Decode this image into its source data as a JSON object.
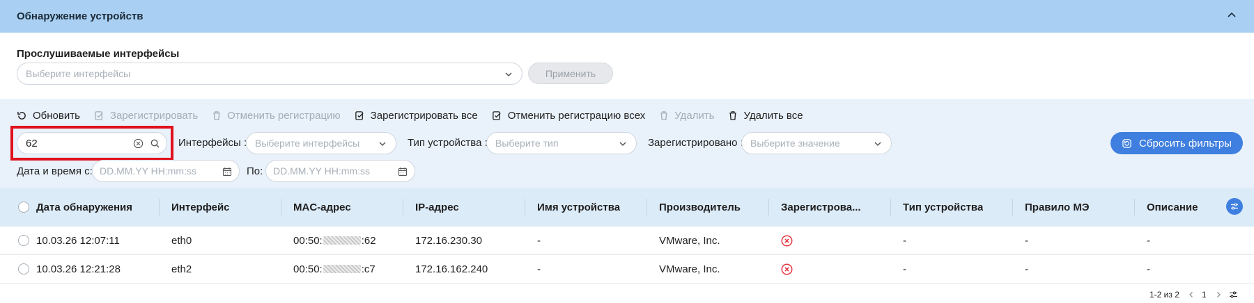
{
  "header": {
    "title": "Обнаружение устройств",
    "collapse_icon": "chevron-up-icon"
  },
  "listen": {
    "label": "Прослушиваемые интерфейсы",
    "placeholder": "Выберите интерфейсы",
    "apply_label": "Применить"
  },
  "toolbar": {
    "refresh": "Обновить",
    "register": "Зарегистрировать",
    "unregister": "Отменить регистрацию",
    "register_all": "Зарегистрировать все",
    "unregister_all": "Отменить регистрацию всех",
    "delete": "Удалить",
    "delete_all": "Удалить все"
  },
  "filters": {
    "search_value": "62",
    "interfaces_label": "Интерфейсы :",
    "interfaces_placeholder": "Выберите интерфейсы",
    "device_type_label": "Тип устройства :",
    "device_type_placeholder": "Выберите тип",
    "registered_label": "Зарегистрировано :",
    "registered_placeholder": "Выберите значение",
    "reset_label": "Сбросить фильтры",
    "date_from_label": "Дата и время с:",
    "date_from_placeholder": "DD.MM.YY HH:mm:ss",
    "date_to_label": "По:",
    "date_to_placeholder": "DD.MM.YY HH:mm:ss"
  },
  "table": {
    "columns": [
      "Дата обнаружения",
      "Интерфейс",
      "MAC-адрес",
      "IP-адрес",
      "Имя устройства",
      "Производитель",
      "Зарегистрова...",
      "Тип устройства",
      "Правило МЭ",
      "Описание"
    ],
    "rows": [
      {
        "date": "10.03.26 12:07:11",
        "iface": "eth0",
        "mac_prefix": "00:50:",
        "mac_suffix": ":62",
        "ip": "172.16.230.30",
        "name": "-",
        "vendor": "VMware, Inc.",
        "registered": "not-registered-icon",
        "type": "-",
        "rule": "-",
        "desc": "-"
      },
      {
        "date": "10.03.26 12:21:28",
        "iface": "eth2",
        "mac_prefix": "00:50:",
        "mac_suffix": ":c7",
        "ip": "172.16.162.240",
        "name": "-",
        "vendor": "VMware, Inc.",
        "registered": "not-registered-icon",
        "type": "-",
        "rule": "-",
        "desc": "-"
      }
    ]
  },
  "pagination": {
    "range": "1-2 из 2",
    "page": "1"
  },
  "colors": {
    "header_bg": "#a9d0f2",
    "panel_bg": "#e9f2fb",
    "accent": "#3f7fe0",
    "highlight": "#e0101c",
    "error": "#e5333d"
  }
}
